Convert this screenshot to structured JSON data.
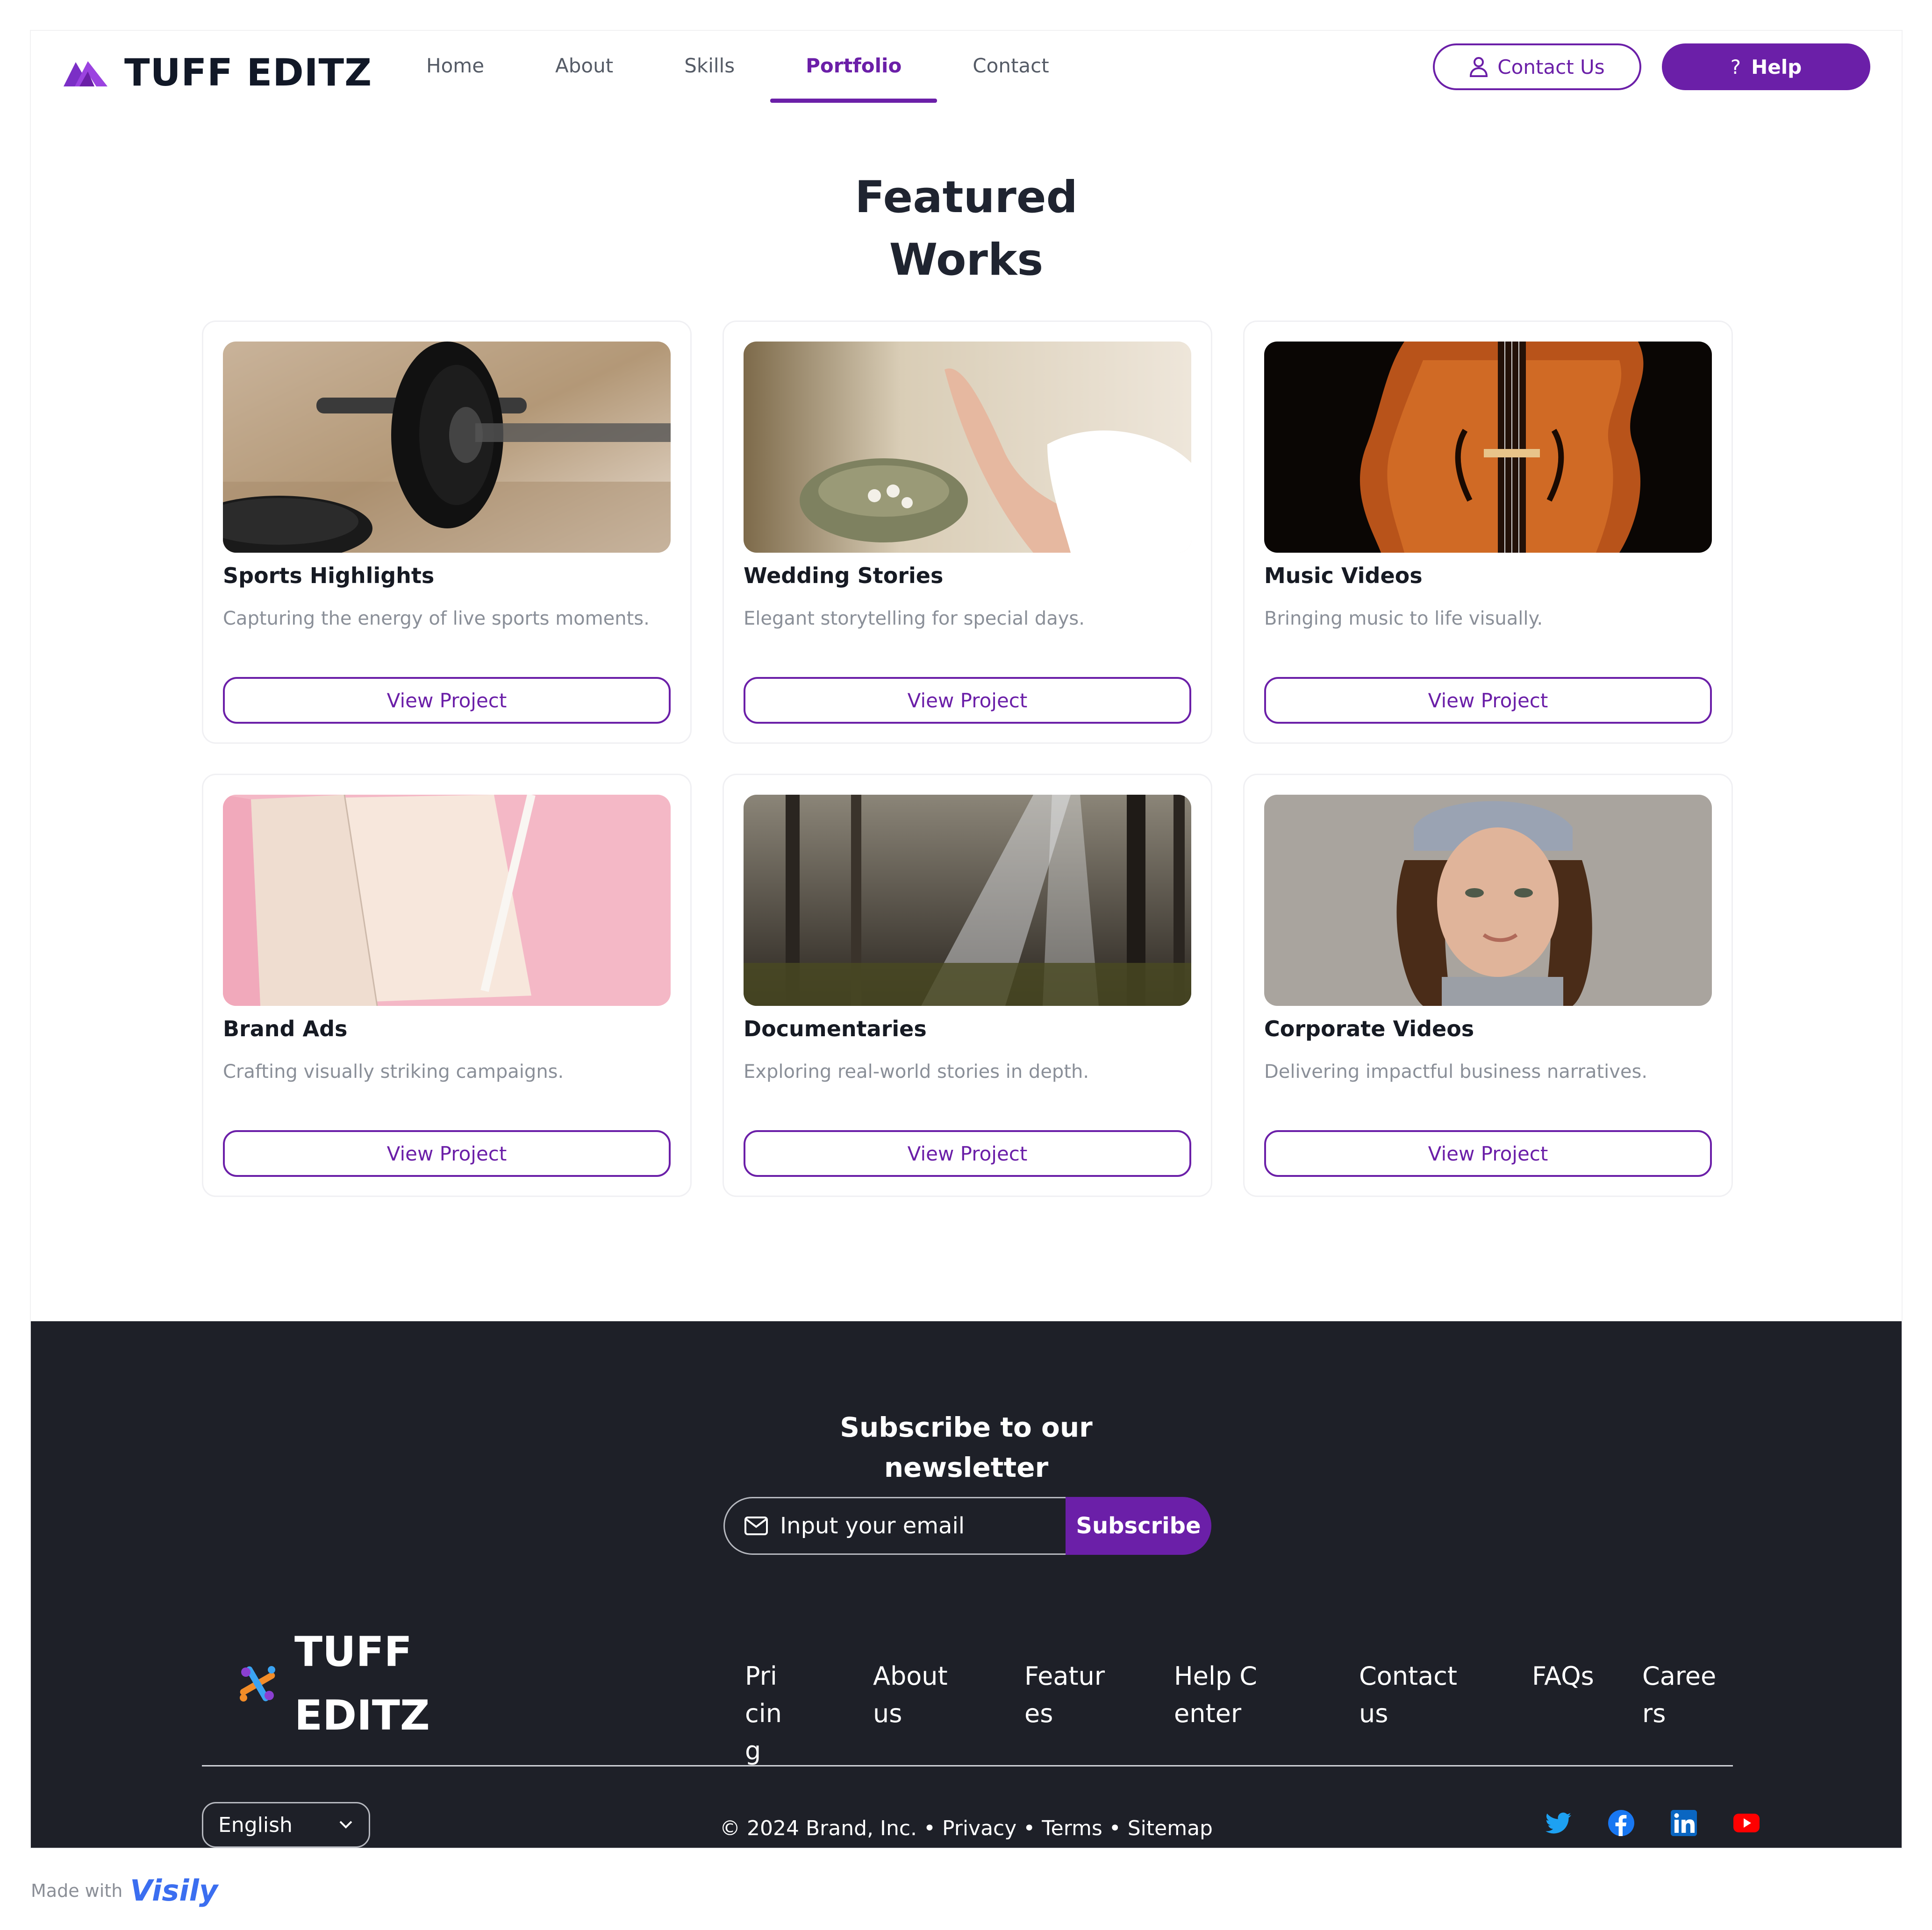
{
  "brand": {
    "name": "TUFF EDITZ"
  },
  "nav": {
    "links": [
      {
        "label": "Home",
        "active": false
      },
      {
        "label": "About",
        "active": false
      },
      {
        "label": "Skills",
        "active": false
      },
      {
        "label": "Portfolio",
        "active": true
      },
      {
        "label": "Contact",
        "active": false
      }
    ],
    "contact_button": "Contact Us",
    "help_button": "Help",
    "help_icon_glyph": "?"
  },
  "colors": {
    "accent": "#6b1fa8",
    "footer_bg": "#1e2028",
    "muted_text": "#8a8f98"
  },
  "portfolio": {
    "title_line1": "Featured",
    "title_line2": "Works",
    "cards": [
      {
        "title": "Sports Highlights",
        "description": "Capturing the energy of live sports moments.",
        "button": "View Project",
        "image": "barbell-weight-plates"
      },
      {
        "title": "Wedding Stories",
        "description": "Elegant storytelling for special days.",
        "button": "View Project",
        "image": "hand-with-ring-and-bowl"
      },
      {
        "title": "Music Videos",
        "description": "Bringing music to life visually.",
        "button": "View Project",
        "image": "violin-closeup"
      },
      {
        "title": "Brand Ads",
        "description": "Crafting visually striking campaigns.",
        "button": "View Project",
        "image": "notebook-on-pink"
      },
      {
        "title": "Documentaries",
        "description": "Exploring real-world stories in depth.",
        "button": "View Project",
        "image": "forest-sunbeams"
      },
      {
        "title": "Corporate Videos",
        "description": "Delivering impactful business narratives.",
        "button": "View Project",
        "image": "woman-portrait-beanie"
      }
    ]
  },
  "newsletter": {
    "title_line1": "Subscribe to our",
    "title_line2": "newsletter",
    "email_placeholder": "Input your email",
    "subscribe_button": "Subscribe"
  },
  "footer": {
    "brand_line1": "TUFF",
    "brand_line2": "EDITZ",
    "links": [
      "Pricing",
      "About us",
      "Features",
      "Help Center",
      "Contact us",
      "FAQs",
      "Careers"
    ],
    "language": "English",
    "copyright": "© 2024 Brand, Inc.",
    "legal_links": [
      "Privacy",
      "Terms",
      "Sitemap"
    ],
    "socials": [
      "twitter-icon",
      "facebook-icon",
      "linkedin-icon",
      "youtube-icon"
    ]
  },
  "made_with": {
    "prefix": "Made with",
    "product": "Visily"
  }
}
